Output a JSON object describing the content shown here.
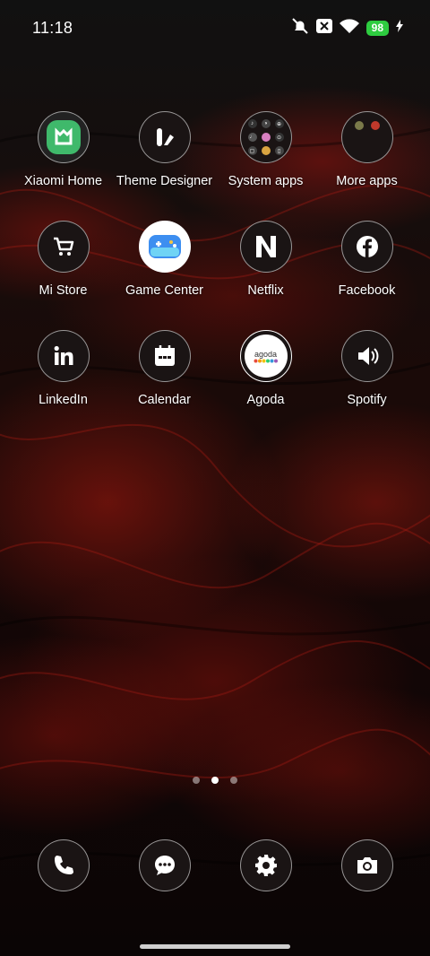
{
  "status_bar": {
    "time": "11:18",
    "battery": "98",
    "icons": [
      "mute-icon",
      "no-sim-icon",
      "wifi-icon",
      "battery-icon",
      "charging-icon"
    ]
  },
  "apps": [
    {
      "label": "Xiaomi Home",
      "icon": "xiaomi-home-icon"
    },
    {
      "label": "Theme Designer",
      "icon": "theme-designer-icon"
    },
    {
      "label": "System apps",
      "icon": "system-apps-folder-icon"
    },
    {
      "label": "More apps",
      "icon": "more-apps-folder-icon"
    },
    {
      "label": "Mi Store",
      "icon": "cart-icon"
    },
    {
      "label": "Game Center",
      "icon": "gamepad-icon"
    },
    {
      "label": "Netflix",
      "icon": "netflix-icon"
    },
    {
      "label": "Facebook",
      "icon": "facebook-icon"
    },
    {
      "label": "LinkedIn",
      "icon": "linkedin-icon"
    },
    {
      "label": "Calendar",
      "icon": "calendar-icon"
    },
    {
      "label": "Agoda",
      "icon": "agoda-icon",
      "text": "agoda"
    },
    {
      "label": "Spotify",
      "icon": "speaker-icon"
    }
  ],
  "page_indicator": {
    "pages": 3,
    "current": 2
  },
  "dock": [
    {
      "name": "phone",
      "icon": "phone-icon"
    },
    {
      "name": "messages",
      "icon": "message-icon"
    },
    {
      "name": "settings",
      "icon": "gear-icon"
    },
    {
      "name": "camera",
      "icon": "camera-icon"
    }
  ],
  "colors": {
    "battery": "#2ecc40",
    "agoda_dots": [
      "#e74c3c",
      "#f39c12",
      "#f1c40f",
      "#2ecc71",
      "#3498db",
      "#9b59b6"
    ]
  }
}
